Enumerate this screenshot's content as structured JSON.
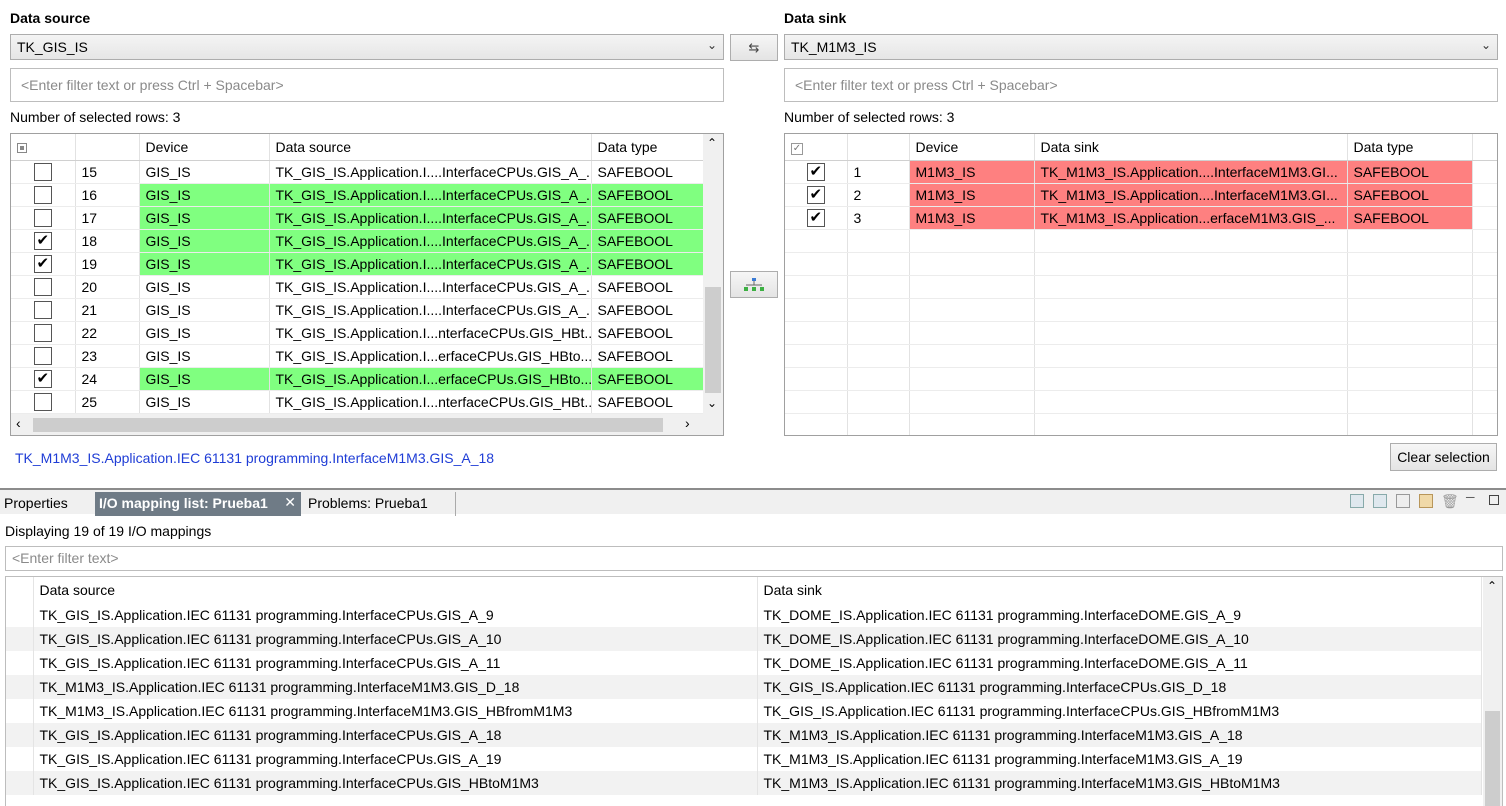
{
  "source": {
    "label": "Data source",
    "selected": "TK_GIS_IS",
    "filter_placeholder": "<Enter filter text or press Ctrl + Spacebar>",
    "selected_count": "Number of selected rows: 3",
    "columns": [
      "",
      "",
      "Device",
      "Data source",
      "Data type"
    ],
    "rows": [
      {
        "num": "15",
        "device": "GIS_IS",
        "path": "TK_GIS_IS.Application.I....InterfaceCPUs.GIS_A_...",
        "type": "SAFEBOOL",
        "checked": false,
        "highlight": false
      },
      {
        "num": "16",
        "device": "GIS_IS",
        "path": "TK_GIS_IS.Application.I....InterfaceCPUs.GIS_A_...",
        "type": "SAFEBOOL",
        "checked": false,
        "highlight": true
      },
      {
        "num": "17",
        "device": "GIS_IS",
        "path": "TK_GIS_IS.Application.I....InterfaceCPUs.GIS_A_...",
        "type": "SAFEBOOL",
        "checked": false,
        "highlight": true
      },
      {
        "num": "18",
        "device": "GIS_IS",
        "path": "TK_GIS_IS.Application.I....InterfaceCPUs.GIS_A_...",
        "type": "SAFEBOOL",
        "checked": true,
        "highlight": true
      },
      {
        "num": "19",
        "device": "GIS_IS",
        "path": "TK_GIS_IS.Application.I....InterfaceCPUs.GIS_A_...",
        "type": "SAFEBOOL",
        "checked": true,
        "highlight": true
      },
      {
        "num": "20",
        "device": "GIS_IS",
        "path": "TK_GIS_IS.Application.I....InterfaceCPUs.GIS_A_...",
        "type": "SAFEBOOL",
        "checked": false,
        "highlight": false
      },
      {
        "num": "21",
        "device": "GIS_IS",
        "path": "TK_GIS_IS.Application.I....InterfaceCPUs.GIS_A_...",
        "type": "SAFEBOOL",
        "checked": false,
        "highlight": false
      },
      {
        "num": "22",
        "device": "GIS_IS",
        "path": "TK_GIS_IS.Application.I...nterfaceCPUs.GIS_HBt...",
        "type": "SAFEBOOL",
        "checked": false,
        "highlight": false
      },
      {
        "num": "23",
        "device": "GIS_IS",
        "path": "TK_GIS_IS.Application.I...erfaceCPUs.GIS_HBto...",
        "type": "SAFEBOOL",
        "checked": false,
        "highlight": false
      },
      {
        "num": "24",
        "device": "GIS_IS",
        "path": "TK_GIS_IS.Application.I...erfaceCPUs.GIS_HBto...",
        "type": "SAFEBOOL",
        "checked": true,
        "highlight": true
      },
      {
        "num": "25",
        "device": "GIS_IS",
        "path": "TK_GIS_IS.Application.I...nterfaceCPUs.GIS_HBt...",
        "type": "SAFEBOOL",
        "checked": false,
        "highlight": false
      }
    ],
    "status_path": "TK_M1M3_IS.Application.IEC 61131 programming.InterfaceM1M3.GIS_A_18"
  },
  "sink": {
    "label": "Data sink",
    "selected": "TK_M1M3_IS",
    "filter_placeholder": "<Enter filter text or press Ctrl + Spacebar>",
    "selected_count": "Number of selected rows: 3",
    "columns": [
      "",
      "",
      "Device",
      "Data sink",
      "Data type"
    ],
    "rows": [
      {
        "num": "1",
        "device": "M1M3_IS",
        "path": "TK_M1M3_IS.Application....InterfaceM1M3.GI...",
        "type": "SAFEBOOL",
        "checked": true
      },
      {
        "num": "2",
        "device": "M1M3_IS",
        "path": "TK_M1M3_IS.Application....InterfaceM1M3.GI...",
        "type": "SAFEBOOL",
        "checked": true
      },
      {
        "num": "3",
        "device": "M1M3_IS",
        "path": "TK_M1M3_IS.Application...erfaceM1M3.GIS_...",
        "type": "SAFEBOOL",
        "checked": true
      }
    ],
    "clear_label": "Clear selection"
  },
  "tabs": {
    "properties": "Properties",
    "io_mapping": "I/O mapping list: Prueba1",
    "problems": "Problems: Prueba1"
  },
  "mapping": {
    "count_text": "Displaying 19 of 19 I/O mappings",
    "filter_placeholder": "<Enter filter text>",
    "col_source": "Data source",
    "col_sink": "Data sink",
    "rows": [
      {
        "source": "TK_GIS_IS.Application.IEC 61131 programming.InterfaceCPUs.GIS_A_9",
        "sink": "TK_DOME_IS.Application.IEC 61131 programming.InterfaceDOME.GIS_A_9"
      },
      {
        "source": "TK_GIS_IS.Application.IEC 61131 programming.InterfaceCPUs.GIS_A_10",
        "sink": "TK_DOME_IS.Application.IEC 61131 programming.InterfaceDOME.GIS_A_10"
      },
      {
        "source": "TK_GIS_IS.Application.IEC 61131 programming.InterfaceCPUs.GIS_A_11",
        "sink": "TK_DOME_IS.Application.IEC 61131 programming.InterfaceDOME.GIS_A_11"
      },
      {
        "source": "TK_M1M3_IS.Application.IEC 61131 programming.InterfaceM1M3.GIS_D_18",
        "sink": "TK_GIS_IS.Application.IEC 61131 programming.InterfaceCPUs.GIS_D_18"
      },
      {
        "source": "TK_M1M3_IS.Application.IEC 61131 programming.InterfaceM1M3.GIS_HBfromM1M3",
        "sink": "TK_GIS_IS.Application.IEC 61131 programming.InterfaceCPUs.GIS_HBfromM1M3"
      },
      {
        "source": "TK_GIS_IS.Application.IEC 61131 programming.InterfaceCPUs.GIS_A_18",
        "sink": "TK_M1M3_IS.Application.IEC 61131 programming.InterfaceM1M3.GIS_A_18"
      },
      {
        "source": "TK_GIS_IS.Application.IEC 61131 programming.InterfaceCPUs.GIS_A_19",
        "sink": "TK_M1M3_IS.Application.IEC 61131 programming.InterfaceM1M3.GIS_A_19"
      },
      {
        "source": "TK_GIS_IS.Application.IEC 61131 programming.InterfaceCPUs.GIS_HBtoM1M3",
        "sink": "TK_M1M3_IS.Application.IEC 61131 programming.InterfaceM1M3.GIS_HBtoM1M3"
      }
    ]
  },
  "colors": {
    "source_highlight": "#80ff80",
    "sink_highlight": "#fe8080",
    "active_tab": "#6f7b86",
    "link": "#1f3dd6"
  }
}
